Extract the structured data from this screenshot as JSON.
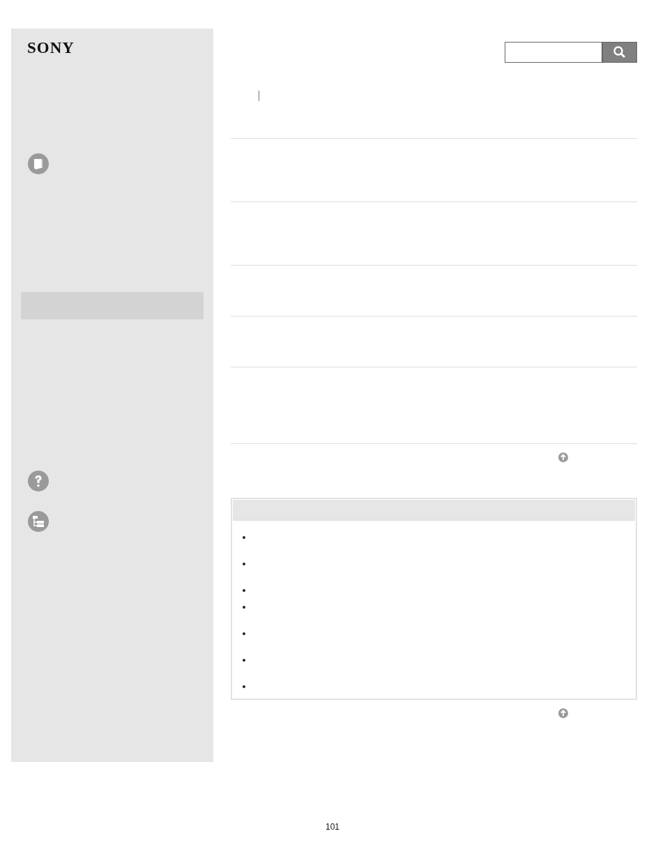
{
  "logo": "SONY",
  "page_number": "101"
}
